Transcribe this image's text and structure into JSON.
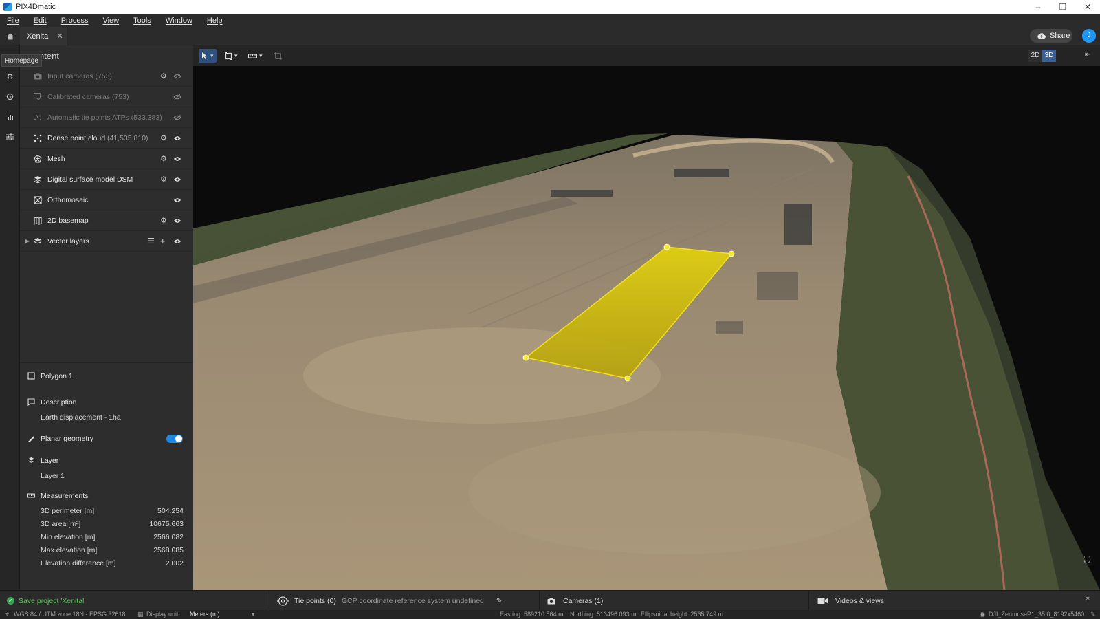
{
  "app": {
    "title": "PIX4Dmatic"
  },
  "window_controls": {
    "minimize": "–",
    "maximize": "❐",
    "close": "✕"
  },
  "menu": [
    "File",
    "Edit",
    "Process",
    "View",
    "Tools",
    "Window",
    "Help"
  ],
  "tabs": {
    "active": "Xenital",
    "tooltip": "Homepage"
  },
  "header": {
    "share_label": "Share",
    "avatar_initial": "J"
  },
  "content_panel": {
    "title_partial": "ntent",
    "layers": [
      {
        "name": "Input cameras (753)",
        "count": "",
        "dim": true,
        "gear": true,
        "eye": "hidden"
      },
      {
        "name": "Calibrated cameras (753)",
        "count": "",
        "dim": true,
        "gear": false,
        "eye": "hidden"
      },
      {
        "name": "Automatic tie points ATPs (533,383)",
        "count": "",
        "dim": true,
        "gear": false,
        "eye": "hidden"
      },
      {
        "name": "Dense point cloud",
        "count": "(41,535,810)",
        "dim": false,
        "gear": true,
        "eye": "visible"
      },
      {
        "name": "Mesh",
        "count": "",
        "dim": false,
        "gear": true,
        "eye": "visible"
      },
      {
        "name": "Digital surface model DSM",
        "count": "",
        "dim": false,
        "gear": true,
        "eye": "visible"
      },
      {
        "name": "Orthomosaic",
        "count": "",
        "dim": false,
        "gear": false,
        "eye": "visible"
      },
      {
        "name": "2D basemap",
        "count": "",
        "dim": false,
        "gear": true,
        "eye": "visible"
      },
      {
        "name": "Vector layers",
        "count": "",
        "dim": false,
        "gear": false,
        "eye": "visible"
      }
    ]
  },
  "properties": {
    "object_name": "Polygon 1",
    "description_label": "Description",
    "description_value": "Earth displacement - 1ha",
    "planar_label": "Planar geometry",
    "planar_enabled": true,
    "layer_label": "Layer",
    "layer_value": "Layer 1",
    "measurements_label": "Measurements",
    "measurements": [
      {
        "label": "3D perimeter [m]",
        "value": "504.254"
      },
      {
        "label": "3D area [m²]",
        "value": "10675.663"
      },
      {
        "label": "Min elevation [m]",
        "value": "2566.082"
      },
      {
        "label": "Max elevation [m]",
        "value": "2568.085"
      },
      {
        "label": "Elevation difference [m]",
        "value": "2.002"
      }
    ]
  },
  "viewport": {
    "mode_2d": "2D",
    "mode_3d": "3D",
    "active_mode": "3D",
    "polygon_color": "#d4c400"
  },
  "bottom_bar": {
    "save_status": "Save project 'Xenital'",
    "tie_points": "Tie points (0)",
    "gcp_status": "GCP coordinate reference system undefined",
    "cameras": "Cameras (1)",
    "videos": "Videos & views"
  },
  "status_bar": {
    "crs": "WGS 84 / UTM zone 18N - EPSG:32618",
    "display_unit_label": "Display unit:",
    "display_unit_value": "Meters (m)",
    "easting": "Easting: 589210.564 m",
    "northing": "Northing: 513496.093 m",
    "height": "Ellipsoidal height: 2565.749 m",
    "camera": "DJI_ZenmuseP1_35.0_8192x5460"
  },
  "colors": {
    "accent": "#1e88e5",
    "success": "#3aa655"
  }
}
